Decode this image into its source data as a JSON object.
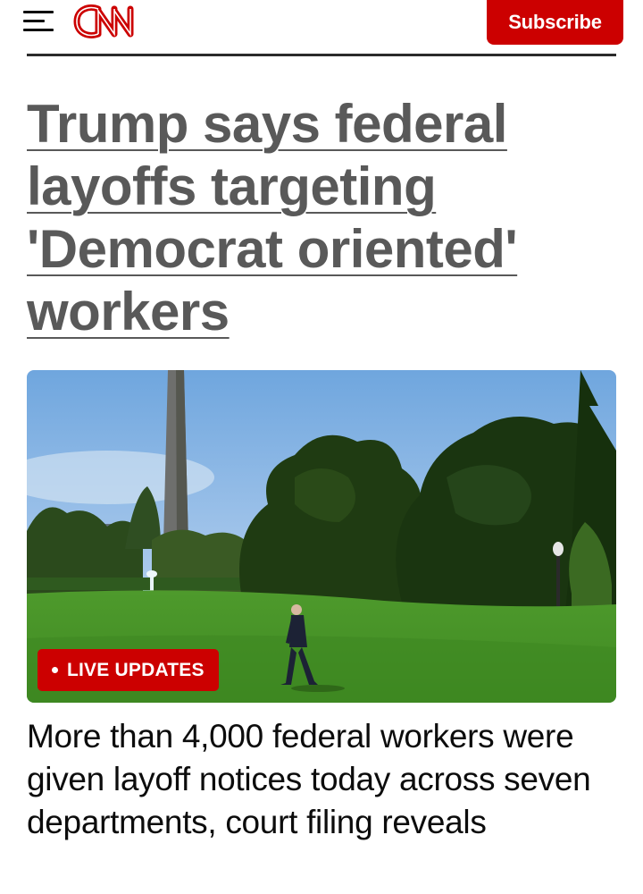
{
  "header": {
    "menu_icon": "hamburger-menu-icon",
    "logo_text": "CNN",
    "subscribe_label": "Subscribe",
    "brand_color": "#cc0000"
  },
  "article": {
    "headline": "Trump says federal layoffs targeting 'Democrat oriented' workers",
    "hero_image_alt": "Trump walks across the White House South Lawn with the Washington Monument in the background",
    "live_badge_label": "LIVE UPDATES",
    "subheadline": "More than 4,000 federal workers were given layoff notices today across seven departments, court filing reveals"
  }
}
